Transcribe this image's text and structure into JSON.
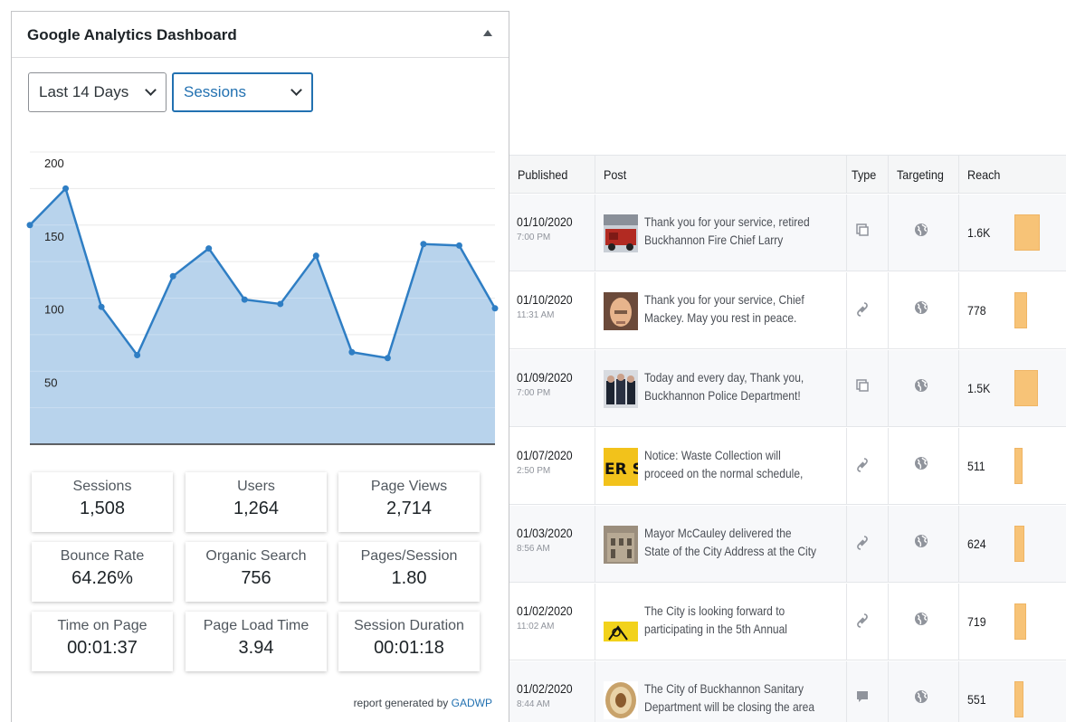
{
  "widget": {
    "title": "Google Analytics Dashboard",
    "period_select": "Last 14 Days",
    "metric_select": "Sessions",
    "footer_text": "report generated by",
    "footer_link": "GADWP"
  },
  "chart_data": {
    "type": "area",
    "x": [
      1,
      2,
      3,
      4,
      5,
      6,
      7,
      8,
      9,
      10,
      11,
      12,
      13,
      14
    ],
    "series": [
      {
        "values": [
          150,
          175,
          94,
          61,
          115,
          134,
          99,
          96,
          129,
          63,
          59,
          137,
          136,
          93
        ]
      }
    ],
    "ylim": [
      0,
      200
    ],
    "yticks": [
      200,
      150,
      100,
      50
    ],
    "ytick_labels": [
      "200",
      "150",
      "100",
      "50"
    ],
    "grid": true,
    "line_color": "#2f7ec4",
    "fill_color": "#b8d3ec"
  },
  "kpis": [
    {
      "label": "Sessions",
      "value": "1,508"
    },
    {
      "label": "Users",
      "value": "1,264"
    },
    {
      "label": "Page Views",
      "value": "2,714"
    },
    {
      "label": "Bounce Rate",
      "value": "64.26%"
    },
    {
      "label": "Organic Search",
      "value": "756"
    },
    {
      "label": "Pages/Session",
      "value": "1.80"
    },
    {
      "label": "Time on Page",
      "value": "00:01:37"
    },
    {
      "label": "Page Load Time",
      "value": "3.94"
    },
    {
      "label": "Session Duration",
      "value": "00:01:18"
    }
  ],
  "posts_table": {
    "headers": {
      "published": "Published",
      "post": "Post",
      "type": "Type",
      "targeting": "Targeting",
      "reach": "Reach"
    },
    "bar_color": "#f7c377",
    "rows": [
      {
        "date": "01/10/2020",
        "time": "7:00 PM",
        "line1": "Thank you for your service, retired",
        "line2": "Buckhannon Fire Chief Larry",
        "type": "album-icon",
        "reach": "1.6K",
        "reach_value": 1600,
        "thumb": "fire-truck"
      },
      {
        "date": "01/10/2020",
        "time": "11:31 AM",
        "line1": "Thank you for your service, Chief",
        "line2": "Mackey. May you rest in peace.",
        "type": "link-icon",
        "reach": "778",
        "reach_value": 778,
        "thumb": "portrait"
      },
      {
        "date": "01/09/2020",
        "time": "7:00 PM",
        "line1": "Today and every day, Thank you,",
        "line2": "Buckhannon Police Department!",
        "type": "album-icon",
        "reach": "1.5K",
        "reach_value": 1500,
        "thumb": "police"
      },
      {
        "date": "01/07/2020",
        "time": "2:50 PM",
        "line1": "Notice: Waste Collection will",
        "line2": "proceed on the normal schedule,",
        "type": "link-icon",
        "reach": "511",
        "reach_value": 511,
        "thumb": "ers",
        "thumb_text": "ER S"
      },
      {
        "date": "01/03/2020",
        "time": "8:56 AM",
        "line1": "Mayor McCauley delivered the",
        "line2": "State of the City Address at the City",
        "type": "link-icon",
        "reach": "624",
        "reach_value": 624,
        "thumb": "building"
      },
      {
        "date": "01/02/2020",
        "time": "11:02 AM",
        "line1": "The City is looking forward to",
        "line2": "participating in the 5th Annual",
        "type": "link-icon",
        "reach": "719",
        "reach_value": 719,
        "thumb": "yellow"
      },
      {
        "date": "01/02/2020",
        "time": "8:44 AM",
        "line1": "The City of Buckhannon Sanitary",
        "line2": "Department will be closing the area",
        "type": "status-icon",
        "reach": "551",
        "reach_value": 551,
        "thumb": "seal"
      }
    ]
  }
}
